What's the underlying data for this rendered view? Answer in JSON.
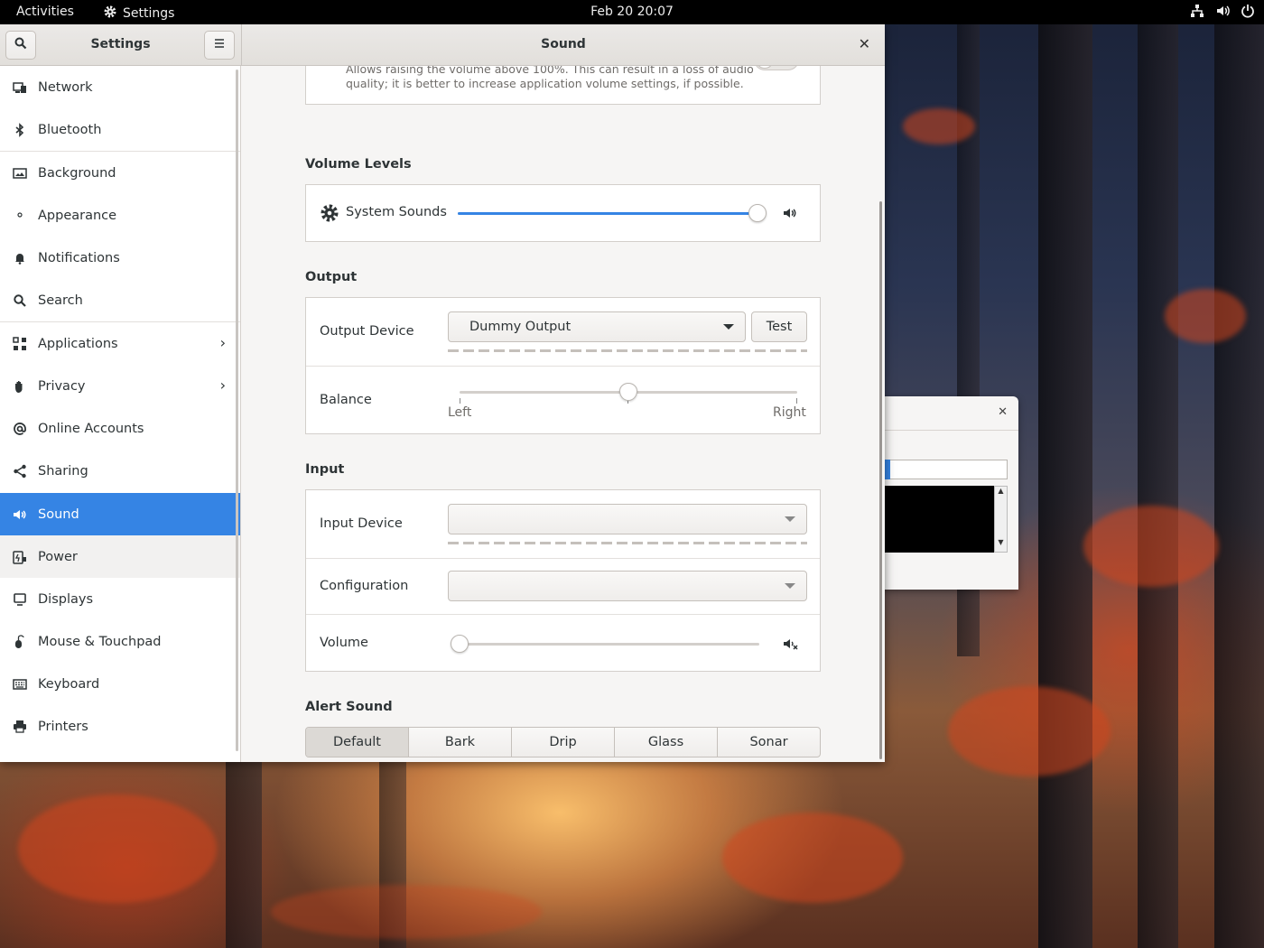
{
  "topbar": {
    "activities": "Activities",
    "app_name": "Settings",
    "clock": "Feb 20  20:07"
  },
  "settings": {
    "sidebar_title": "Settings",
    "panel_title": "Sound"
  },
  "sidebar": {
    "items": [
      {
        "label": "Network",
        "icon": "network-icon"
      },
      {
        "label": "Bluetooth",
        "icon": "bluetooth-icon"
      },
      {
        "label": "Background",
        "icon": "background-icon"
      },
      {
        "label": "Appearance",
        "icon": "appearance-icon"
      },
      {
        "label": "Notifications",
        "icon": "bell-icon"
      },
      {
        "label": "Search",
        "icon": "search-icon"
      },
      {
        "label": "Applications",
        "icon": "grid-icon"
      },
      {
        "label": "Privacy",
        "icon": "hand-icon"
      },
      {
        "label": "Online Accounts",
        "icon": "at-icon"
      },
      {
        "label": "Sharing",
        "icon": "share-icon"
      },
      {
        "label": "Sound",
        "icon": "speaker-icon"
      },
      {
        "label": "Power",
        "icon": "power-icon"
      },
      {
        "label": "Displays",
        "icon": "display-icon"
      },
      {
        "label": "Mouse & Touchpad",
        "icon": "mouse-icon"
      },
      {
        "label": "Keyboard",
        "icon": "keyboard-icon"
      },
      {
        "label": "Printers",
        "icon": "printer-icon"
      }
    ],
    "active": "Sound"
  },
  "sound": {
    "overamp_desc_line1": "Allows raising the volume above 100%. This can result in a loss of audio",
    "overamp_desc_line2": "quality; it is better to increase application volume settings, if possible.",
    "volume_levels": {
      "title": "Volume Levels",
      "system_sounds_label": "System Sounds",
      "system_sounds_level": 1.0
    },
    "output": {
      "title": "Output",
      "device_label": "Output Device",
      "device_value": "Dummy Output",
      "test_label": "Test",
      "balance_label": "Balance",
      "balance_left": "Left",
      "balance_right": "Right",
      "balance_value": 0.5
    },
    "input": {
      "title": "Input",
      "device_label": "Input Device",
      "device_value": "",
      "configuration_label": "Configuration",
      "configuration_value": "",
      "volume_label": "Volume",
      "volume_level": 0.0
    },
    "alert_sound": {
      "title": "Alert Sound",
      "options": [
        "Default",
        "Bark",
        "Drip",
        "Glass",
        "Sonar"
      ],
      "selected": "Default"
    }
  },
  "colors": {
    "accent": "#3584e4",
    "sidebar_active_bg": "#3584e4",
    "window_bg": "#f6f5f4"
  }
}
